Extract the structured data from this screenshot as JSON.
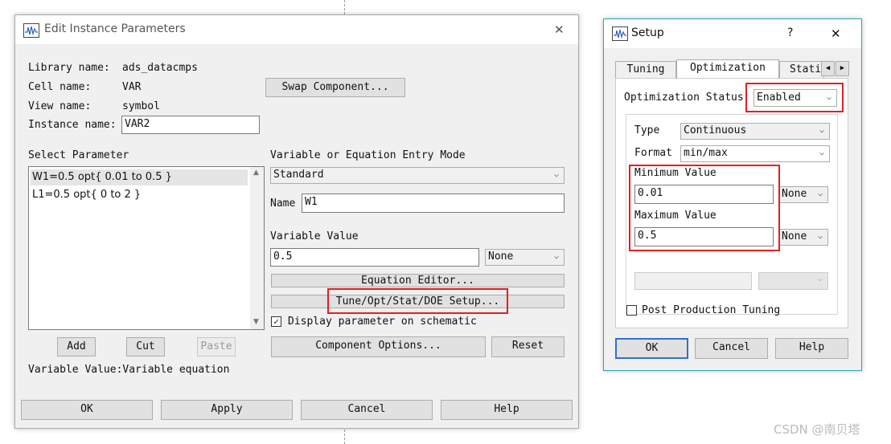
{
  "edit_dialog": {
    "title": "Edit Instance Parameters",
    "library_label": "Library name:",
    "library_value": "ads_datacmps",
    "cell_label": "Cell name:",
    "cell_value": "VAR",
    "view_label": "View name:",
    "view_value": "symbol",
    "instance_label": "Instance name:",
    "instance_value": "VAR2",
    "swap_button": "Swap Component...",
    "select_parameter_label": "Select Parameter",
    "parameters": [
      "W1=0.5 opt{ 0.01 to 0.5 }",
      "L1=0.5 opt{ 0 to 2 }"
    ],
    "add_button": "Add",
    "cut_button": "Cut",
    "paste_button": "Paste",
    "entry_mode_label": "Variable or Equation Entry Mode",
    "entry_mode_value": "Standard",
    "name_label": "Name",
    "name_value": "W1",
    "variable_value_label": "Variable Value",
    "variable_value": "0.5",
    "unit_value": "None",
    "equation_editor_button": "Equation Editor...",
    "tune_button": "Tune/Opt/Stat/DOE Setup...",
    "display_param_label": "Display parameter on schematic",
    "display_param_checked": "✓",
    "component_options_button": "Component Options...",
    "reset_button": "Reset",
    "status_text": "Variable Value:Variable equation",
    "ok_button": "OK",
    "apply_button": "Apply",
    "cancel_button": "Cancel",
    "help_button": "Help",
    "close_glyph": "✕"
  },
  "setup_dialog": {
    "title": "Setup",
    "help_glyph": "?",
    "close_glyph": "✕",
    "tabs": [
      "Tuning",
      "Optimization",
      "Stati"
    ],
    "active_tab": "Optimization",
    "opt_status_label": "Optimization Status",
    "opt_status_value": "Enabled",
    "type_label": "Type",
    "type_value": "Continuous",
    "format_label": "Format",
    "format_value": "min/max",
    "min_label": "Minimum Value",
    "min_value": "0.01",
    "min_unit": "None",
    "max_label": "Maximum Value",
    "max_value": "0.5",
    "max_unit": "None",
    "post_tuning_label": "Post Production Tuning",
    "ok_button": "OK",
    "cancel_button": "Cancel",
    "help_button": "Help"
  },
  "watermark": "CSDN @南贝塔",
  "colors": {
    "highlight_red": "#e02020",
    "setup_titlebar": "#ffffff",
    "selected_row": "#e5e5e5"
  }
}
